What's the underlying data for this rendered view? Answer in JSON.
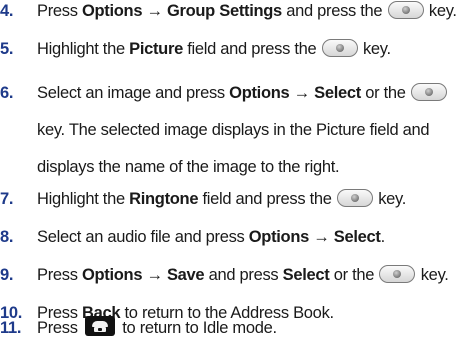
{
  "steps": [
    {
      "number": "4.",
      "parts": [
        {
          "text": "Press "
        },
        {
          "text": "Options → Group Settings",
          "bold": true
        },
        {
          "text": " and press the "
        },
        {
          "key": "ok-key"
        },
        {
          "text": " key."
        }
      ]
    },
    {
      "number": "5.",
      "parts": [
        {
          "text": "Highlight the "
        },
        {
          "text": "Picture",
          "bold": true
        },
        {
          "text": " field and press the "
        },
        {
          "key": "ok-key"
        },
        {
          "text": " key."
        }
      ]
    },
    {
      "number": "6.",
      "parts": [
        {
          "text": "Select an image and press "
        },
        {
          "text": "Options → Select",
          "bold": true
        },
        {
          "text": " or the "
        },
        {
          "key": "ok-key"
        },
        {
          "text": " key. The selected image displays in the Picture field and displays the name of the image to the right."
        }
      ]
    },
    {
      "number": "7.",
      "parts": [
        {
          "text": "Highlight the "
        },
        {
          "text": "Ringtone",
          "bold": true
        },
        {
          "text": " field and press the "
        },
        {
          "key": "ok-key"
        },
        {
          "text": " key."
        }
      ]
    },
    {
      "number": "8.",
      "parts": [
        {
          "text": "Select an audio file and press "
        },
        {
          "text": "Options → Select",
          "bold": true
        },
        {
          "text": "."
        }
      ]
    },
    {
      "number": "9.",
      "parts": [
        {
          "text": "Press "
        },
        {
          "text": "Options → Save",
          "bold": true
        },
        {
          "text": " and press "
        },
        {
          "text": "Select",
          "bold": true
        },
        {
          "text": " or the "
        },
        {
          "key": "ok-key"
        },
        {
          "text": " key."
        }
      ]
    },
    {
      "number": "10.",
      "parts": [
        {
          "text": "Press "
        },
        {
          "text": "Back",
          "bold": true
        },
        {
          "text": " to return to the Address Book."
        }
      ]
    },
    {
      "number": "11.",
      "parts": [
        {
          "text": "Press "
        },
        {
          "key": "end-key"
        },
        {
          "text": " to return to Idle mode."
        }
      ]
    }
  ]
}
